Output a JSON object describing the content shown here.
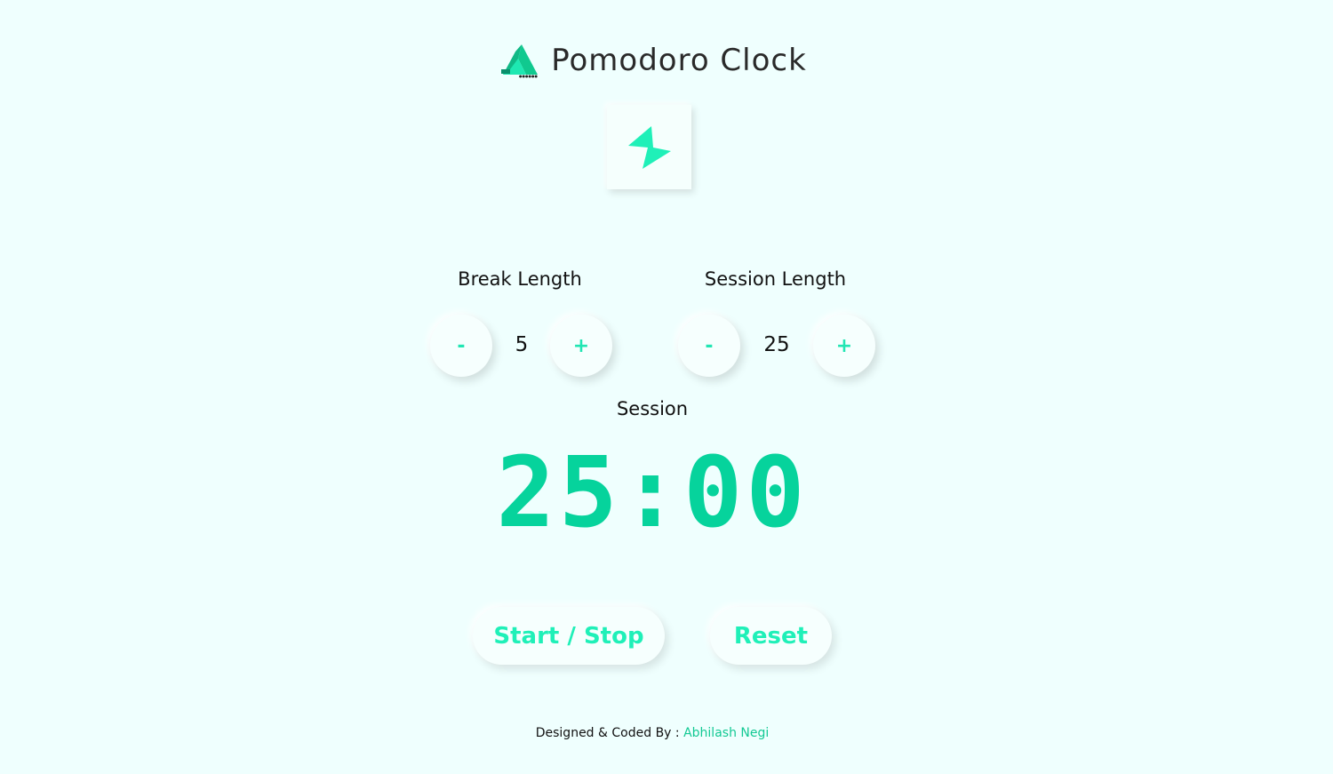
{
  "header": {
    "title": "Pomodoro Clock",
    "logo_icon": "triangle-logo-icon"
  },
  "hero": {
    "icon": "lightning-bolt-icon",
    "accent_color": "#1ff0b8"
  },
  "break": {
    "label": "Break Length",
    "decrement_label": "-",
    "increment_label": "+",
    "value": "5"
  },
  "session": {
    "label": "Session Length",
    "decrement_label": "-",
    "increment_label": "+",
    "value": "25"
  },
  "timer": {
    "label": "Session",
    "time": "25:00",
    "color": "#06d39c"
  },
  "controls": {
    "start_stop_label": "Start / Stop",
    "reset_label": "Reset"
  },
  "footer": {
    "prefix": "Designed & Coded By :",
    "author": "Abhilash Negi"
  }
}
